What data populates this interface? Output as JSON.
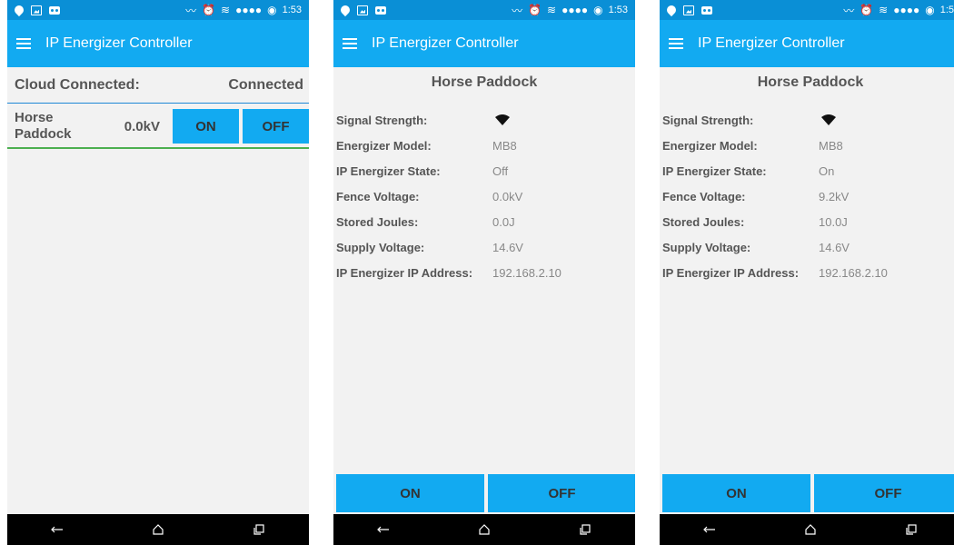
{
  "app_title": "IP Energizer Controller",
  "screens": [
    {
      "status_time": "1:53",
      "cloud_label": "Cloud Connected:",
      "cloud_status": "Connected",
      "device": {
        "name": "Horse Paddock",
        "voltage": "0.0kV",
        "on_label": "ON",
        "off_label": "OFF"
      }
    },
    {
      "status_time": "1:53",
      "title": "Horse Paddock",
      "fields": [
        {
          "label": "Signal Strength:",
          "value": "",
          "icon": "wifi-icon"
        },
        {
          "label": "Energizer Model:",
          "value": "MB8"
        },
        {
          "label": "IP Energizer State:",
          "value": "Off"
        },
        {
          "label": "Fence Voltage:",
          "value": "0.0kV"
        },
        {
          "label": "Stored Joules:",
          "value": "0.0J"
        },
        {
          "label": "Supply Voltage:",
          "value": "14.6V"
        },
        {
          "label": "IP Energizer IP Address:",
          "value": "192.168.2.10"
        }
      ],
      "on_label": "ON",
      "off_label": "OFF"
    },
    {
      "status_time": "1:5",
      "title": "Horse Paddock",
      "fields": [
        {
          "label": "Signal Strength:",
          "value": "",
          "icon": "wifi-icon"
        },
        {
          "label": "Energizer Model:",
          "value": "MB8"
        },
        {
          "label": "IP Energizer State:",
          "value": "On"
        },
        {
          "label": "Fence Voltage:",
          "value": "9.2kV"
        },
        {
          "label": "Stored Joules:",
          "value": "10.0J"
        },
        {
          "label": "Supply Voltage:",
          "value": "14.6V"
        },
        {
          "label": "IP Energizer IP Address:",
          "value": "192.168.2.10"
        }
      ],
      "on_label": "ON",
      "off_label": "OFF"
    }
  ],
  "colors": {
    "status_bar": "#0a8fd6",
    "app_bar": "#12aaf1",
    "button": "#12aaf1",
    "accent_green": "#4caf50",
    "divider_blue": "#1e88d6"
  }
}
